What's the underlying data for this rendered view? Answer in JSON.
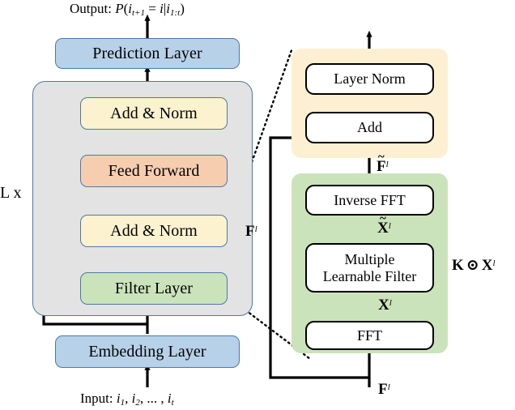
{
  "diagram": {
    "title": "Filter-enhanced sequential recommendation architecture",
    "left_column": {
      "output_label": "Output: P(i",
      "output_label_full": "Output: P(i_{t+1} = i | i_{1:t})",
      "output_parts": {
        "prefix": "Output: ",
        "p": "P",
        "open": "(",
        "i1": "i",
        "sub1": "t+1",
        "eq": " = ",
        "i2": "i",
        "bar": "|",
        "i3": "i",
        "sub3": "1:t",
        "close": ")"
      },
      "input_parts": {
        "prefix": "Input: ",
        "i1": "i",
        "s1": "1",
        "c1": ", ",
        "i2": "i",
        "s2": "2",
        "c2": ", ... , ",
        "i3": "i",
        "s3": "t"
      },
      "repeat_label": "L x",
      "blocks": [
        {
          "id": "prediction-layer",
          "label": "Prediction Layer",
          "color": "#b7d1e8"
        },
        {
          "id": "add-norm-top",
          "label": "Add & Norm",
          "color": "#fdf2cf"
        },
        {
          "id": "feed-forward",
          "label": "Feed Forward",
          "color": "#f7cdb0"
        },
        {
          "id": "add-norm-bottom",
          "label": "Add & Norm",
          "color": "#fdf2cf"
        },
        {
          "id": "filter-layer",
          "label": "Filter Layer",
          "color": "#cbe3ba"
        },
        {
          "id": "embedding-layer",
          "label": "Embedding Layer",
          "color": "#b7d1e8"
        }
      ]
    },
    "right_column": {
      "blocks": [
        {
          "id": "layer-norm",
          "label": "Layer Norm"
        },
        {
          "id": "add",
          "label": "Add"
        },
        {
          "id": "inverse-fft",
          "label": "Inverse FFT"
        },
        {
          "id": "multiple-learnable-filter",
          "label_line1": "Multiple",
          "label_line2": "Learnable Filter"
        },
        {
          "id": "fft",
          "label": "FFT"
        }
      ],
      "signal_labels": {
        "f_tilde_l": {
          "base": "F",
          "tilde": true,
          "sup": "l"
        },
        "x_tilde_l": {
          "base": "X",
          "tilde": true,
          "sup": "l"
        },
        "x_l": {
          "base": "X",
          "tilde": false,
          "sup": "l"
        },
        "f_l_in": {
          "base": "F",
          "tilde": false,
          "sup": "l"
        },
        "f_l_side": {
          "base": "F",
          "tilde": false,
          "sup": "l"
        },
        "k_hadamard_x": {
          "k": "K",
          "op": "⊙",
          "x": "X",
          "sup": "l"
        }
      },
      "containers": [
        {
          "id": "addnorm-group",
          "color": "#fdf0d2"
        },
        {
          "id": "filter-group",
          "color": "#cbe3ba"
        }
      ]
    },
    "colors": {
      "blue_fill": "#b7d1e8",
      "cream_fill": "#fdf2cf",
      "peach_fill": "#f7cdb0",
      "green_fill": "#cbe3ba",
      "gray_panel": "#e3e3e3",
      "yellow_panel": "#fdf0d2",
      "border_blue": "#4c79a8",
      "arrow_black": "#000000"
    }
  }
}
